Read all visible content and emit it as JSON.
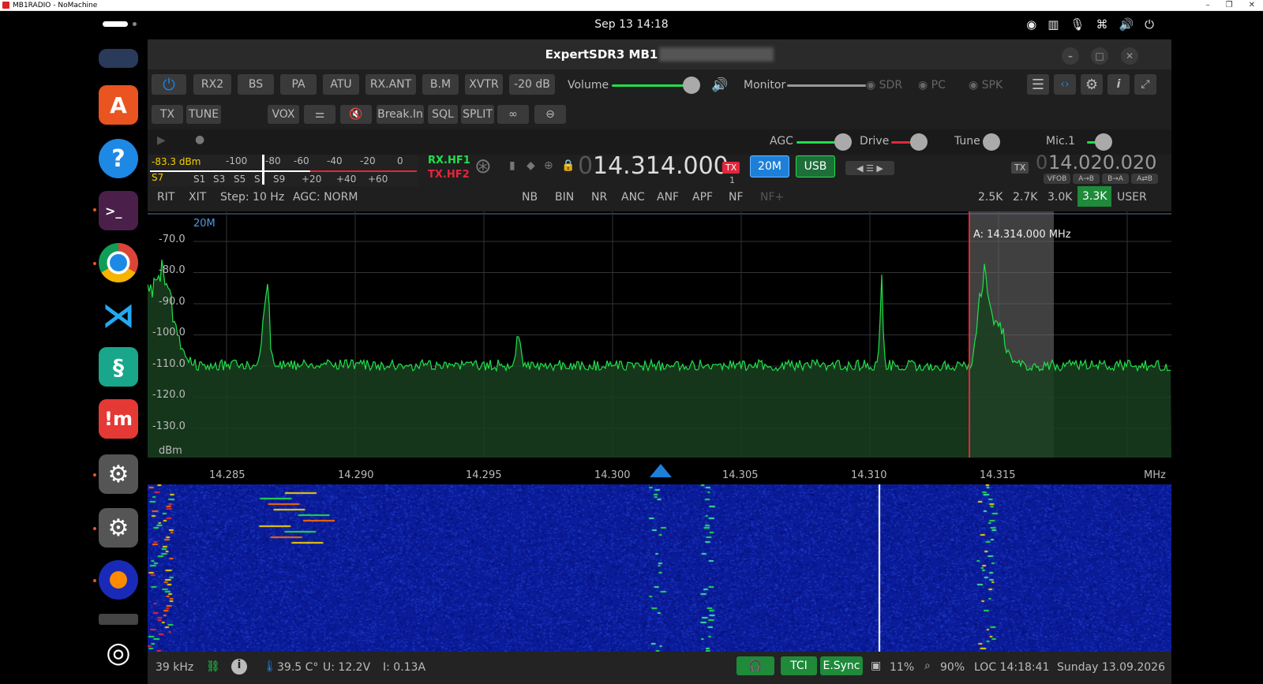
{
  "outer_window": {
    "title": "MB1RADIO - NoMachine"
  },
  "topbar": {
    "datetime": "Sep 13  14:18"
  },
  "window": {
    "title": "ExpertSDR3 MB1"
  },
  "toolbar1": {
    "buttons": [
      "RX2",
      "BS",
      "PA",
      "ATU",
      "RX.ANT",
      "B.M",
      "XVTR",
      "-20 dB"
    ],
    "volume_label": "Volume",
    "monitor_label": "Monitor",
    "sdr_label": "SDR",
    "pc_label": "PC",
    "spk_label": "SPK"
  },
  "toolbar2": {
    "buttons": [
      "TX",
      "TUNE",
      "VOX",
      "Break.In",
      "SQL",
      "SPLIT"
    ]
  },
  "row3": {
    "agc_label": "AGC",
    "drive_label": "Drive",
    "tune_label": "Tune",
    "mic_label": "Mic.1"
  },
  "smeter": {
    "dbm": "-83.3 dBm",
    "s_value": "S7",
    "top_scale": [
      "-100",
      "-80",
      "-60",
      "-40",
      "-20",
      "0"
    ],
    "bottom_scale": [
      "S1",
      "S3",
      "S5",
      "S",
      "S9",
      "+20",
      "+40",
      "+60"
    ],
    "rx_label": "RX.HF1",
    "tx_label": "TX.HF2"
  },
  "vfo_a": {
    "freq_dim": "0",
    "freq": "14.314.000",
    "tx_badge": "TX",
    "sub": "1",
    "band": "20M",
    "mode": "USB"
  },
  "vfo_b": {
    "tx_badge": "TX",
    "freq_dim": "0",
    "freq": "14.020.020",
    "buttons": [
      "VFOB",
      "A→B",
      "B→A",
      "A⇄B"
    ]
  },
  "row4": {
    "rit": "RIT",
    "xit": "XIT",
    "step": "Step: 10 Hz",
    "agc": "AGC: NORM",
    "dsp": [
      "NB",
      "BIN",
      "NR",
      "ANC",
      "ANF",
      "APF",
      "NF",
      "NF+"
    ],
    "filters": [
      "2.5K",
      "2.7K",
      "3.0K",
      "3.3K",
      "USER"
    ],
    "active_filter": "3.3K"
  },
  "spectrum": {
    "band": "20M",
    "unit": "dBm",
    "marker": "A: 14.314.000 MHz",
    "y_ticks": [
      "-70.0",
      "-80.0",
      "-90.0",
      "-100.0",
      "-110.0",
      "-120.0",
      "-130.0"
    ],
    "x_ticks": [
      "14.285",
      "14.290",
      "14.295",
      "14.300",
      "14.305",
      "14.310",
      "14.315"
    ],
    "x_unit": "MHz"
  },
  "status": {
    "span": "39 kHz",
    "temp": "39.5 C°",
    "voltage": "U: 12.2V",
    "current": "I: 0.13A",
    "tci": "TCI",
    "esync": "E.Sync",
    "cpu": "11%",
    "zoom": "90%",
    "loc": "LOC 14:18:41",
    "date": "Sunday 13.09.2026"
  },
  "colors": {
    "accent_green": "#1fe04a",
    "active_blue": "#1e7fd8",
    "tx_red": "#e5263a"
  }
}
